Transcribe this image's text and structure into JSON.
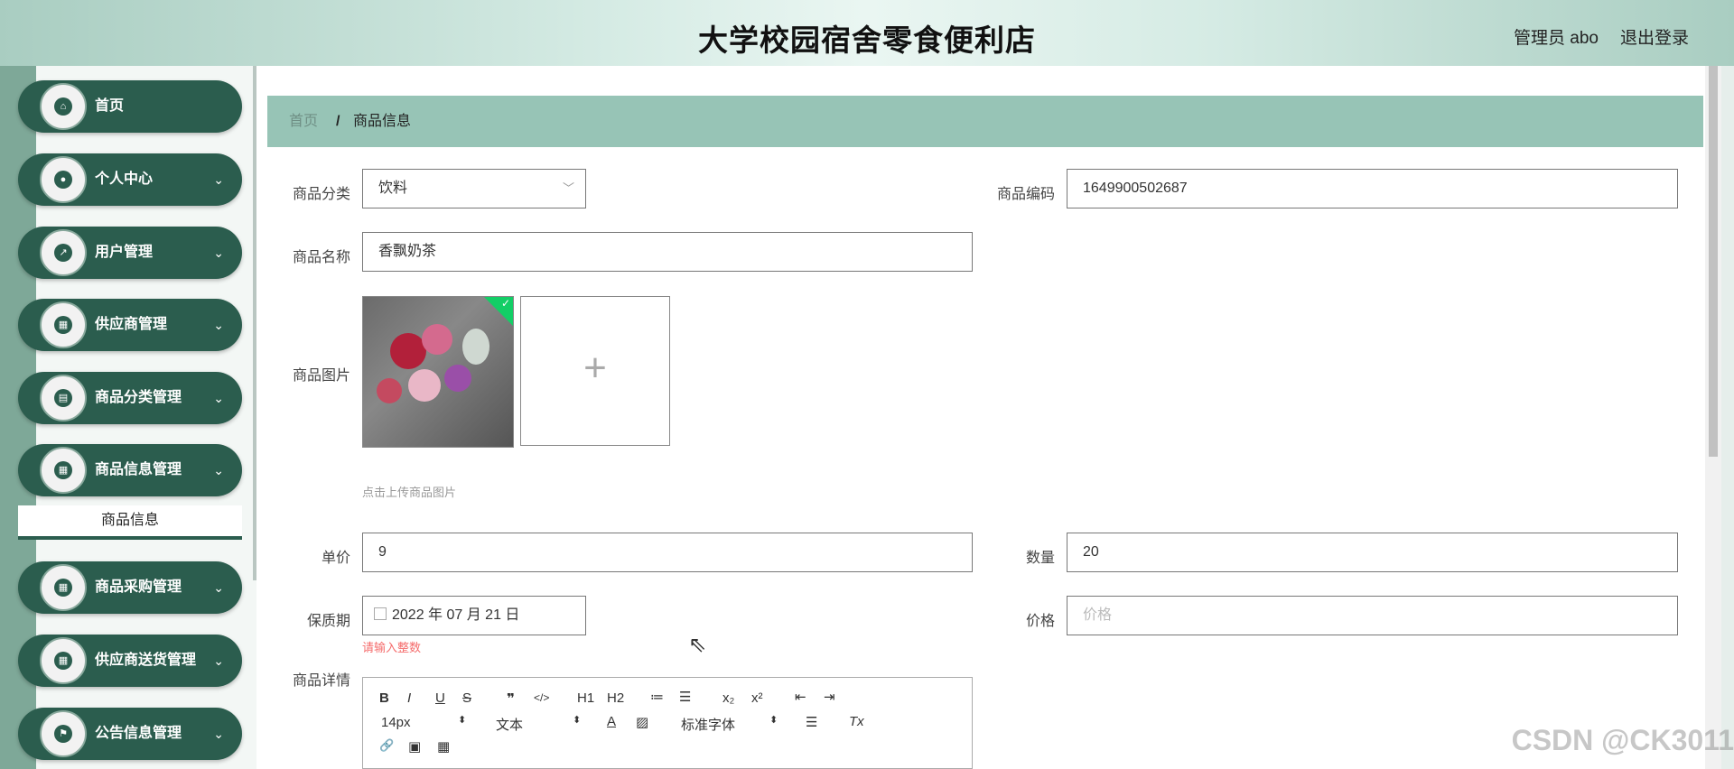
{
  "header": {
    "title": "大学校园宿舍零食便利店",
    "user": "管理员 abo",
    "logout": "退出登录"
  },
  "sidebar": {
    "items": [
      {
        "label": "首页",
        "icon": "home-icon",
        "glyph": "⌂"
      },
      {
        "label": "个人中心",
        "icon": "person-icon",
        "glyph": "●"
      },
      {
        "label": "用户管理",
        "icon": "chart-icon",
        "glyph": "↗"
      },
      {
        "label": "供应商管理",
        "icon": "grid-icon",
        "glyph": "▦"
      },
      {
        "label": "商品分类管理",
        "icon": "clipboard-icon",
        "glyph": "▤"
      },
      {
        "label": "商品信息管理",
        "icon": "grid-icon",
        "glyph": "▦"
      },
      {
        "label": "商品采购管理",
        "icon": "grid-icon",
        "glyph": "▦"
      },
      {
        "label": "供应商送货管理",
        "icon": "grid-icon",
        "glyph": "▦"
      },
      {
        "label": "公告信息管理",
        "icon": "flag-icon",
        "glyph": "⚑"
      }
    ],
    "chevron": "⌄",
    "active_sub": "商品信息"
  },
  "breadcrumb": {
    "home": "首页",
    "sep": "/",
    "current": "商品信息"
  },
  "form": {
    "category_label": "商品分类",
    "category_value": "饮料",
    "code_label": "商品编码",
    "code_value": "1649900502687",
    "name_label": "商品名称",
    "name_value": "香飘奶茶",
    "image_label": "商品图片",
    "upload_hint": "点击上传商品图片",
    "price_label": "单价",
    "price_value": "9",
    "qty_label": "数量",
    "qty_value": "20",
    "expiry_label": "保质期",
    "expiry_value": "2022 年 07 月 21 日",
    "expiry_error": "请输入整数",
    "sale_price_label": "价格",
    "sale_price_placeholder": "价格",
    "detail_label": "商品详情"
  },
  "editor": {
    "row1": [
      "B",
      "I",
      "U",
      "S",
      "❞",
      "</>",
      "H1",
      "H2",
      "≔",
      "☰",
      "x₂",
      "x²",
      "⇤",
      "⇥"
    ],
    "font_size": "14px",
    "text_type": "文本",
    "font_family": "标准字体",
    "clear": "Tx",
    "row3": [
      "🔗",
      "▣",
      "▦"
    ]
  },
  "watermark": "CSDN @CK3011"
}
